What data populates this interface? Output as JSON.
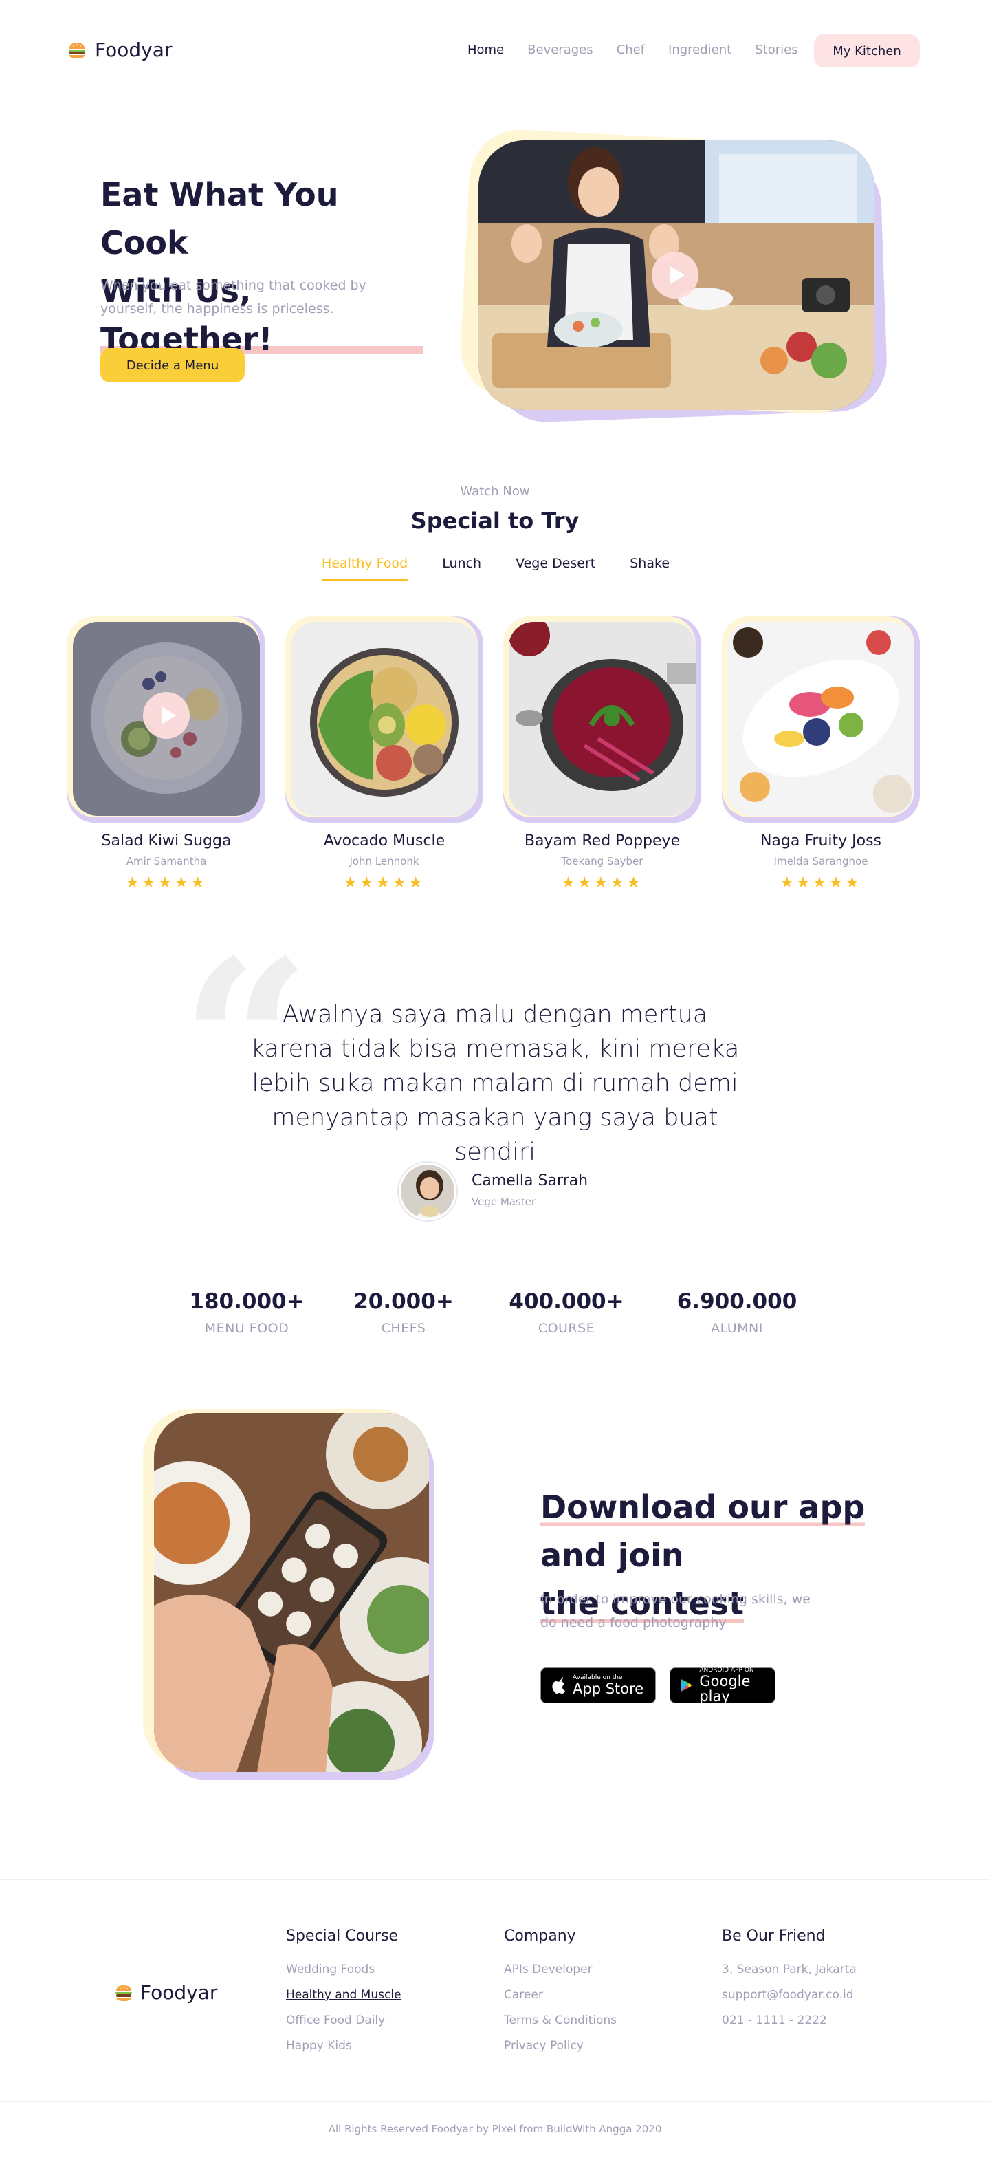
{
  "brand": {
    "name": "Foodyar"
  },
  "nav": {
    "links": [
      "Home",
      "Beverages",
      "Chef",
      "Ingredient",
      "Stories"
    ],
    "active": "Home",
    "cta": "My Kitchen"
  },
  "hero": {
    "title_line1": "Eat What You Cook",
    "title_line2": "With Us, Together!",
    "subtitle": "When you eat something that cooked by yourself, the happiness is priceless.",
    "button": "Decide a Menu"
  },
  "special": {
    "eyebrow": "Watch Now",
    "title": "Special to Try",
    "tabs": [
      "Healthy Food",
      "Lunch",
      "Vege Desert",
      "Shake"
    ],
    "active_tab": "Healthy Food",
    "cards": [
      {
        "name": "Salad Kiwi Sugga",
        "chef": "Amir Samantha",
        "rating": 5
      },
      {
        "name": "Avocado Muscle",
        "chef": "John Lennonk",
        "rating": 5
      },
      {
        "name": "Bayam Red Poppeye",
        "chef": "Toekang Sayber",
        "rating": 5
      },
      {
        "name": "Naga Fruity Joss",
        "chef": "Imelda Saranghoe",
        "rating": 5
      }
    ],
    "stars": "★★★★★"
  },
  "testimonial": {
    "quote": "Awalnya saya malu dengan mertua karena tidak bisa memasak, kini mereka lebih suka makan malam di rumah demi menyantap masakan yang saya buat sendiri",
    "name": "Camella Sarrah",
    "role": "Vege Master"
  },
  "stats": [
    {
      "value": "180.000+",
      "label": "MENU FOOD"
    },
    {
      "value": "20.000+",
      "label": "CHEFS"
    },
    {
      "value": "400.000+",
      "label": "COURSE"
    },
    {
      "value": "6.900.000",
      "label": "ALUMNI"
    }
  ],
  "app": {
    "title_line1": "Download our app",
    "title_line2_a": "and join ",
    "title_line2_b": "the contest",
    "subtitle": "In order to improve our cooking skills, we do need a food photography",
    "appstore_small": "Available on the",
    "appstore_big": "App Store",
    "googleplay_small": "ANDROID APP ON",
    "googleplay_big": "Google play"
  },
  "footer": {
    "columns": [
      {
        "title": "Special Course",
        "items": [
          "Wedding Foods",
          "Healthy and Muscle",
          "Office Food Daily",
          "Happy Kids"
        ]
      },
      {
        "title": "Company",
        "items": [
          "APIs Developer",
          "Career",
          "Terms & Conditions",
          "Privacy Policy"
        ]
      },
      {
        "title": "Be Our Friend",
        "items": [
          "3, Season Park, Jakarta",
          "support@foodyar.co.id",
          "021 - 1111 - 2222"
        ]
      }
    ],
    "copyright": "All Rights Reserved Foodyar by Pixel from BuildWith Angga 2020"
  },
  "colors": {
    "primary_dark": "#1d1b3b",
    "muted": "#a09fb6",
    "accent_yellow": "#f9ce39",
    "accent_pink": "#fde3e3",
    "accent_purple": "#d8cbf4"
  }
}
